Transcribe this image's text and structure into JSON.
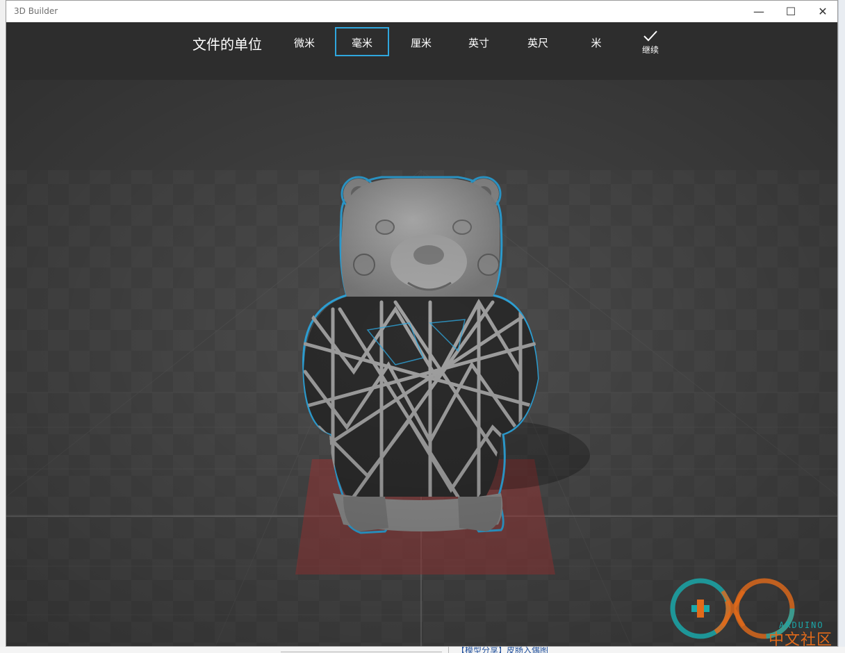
{
  "window": {
    "title": "3D Builder",
    "controls": {
      "minimize": "—",
      "maximize": "☐",
      "close": "✕"
    }
  },
  "toolbar": {
    "title": "文件的单位",
    "units": [
      {
        "label": "微米",
        "selected": false
      },
      {
        "label": "毫米",
        "selected": true
      },
      {
        "label": "厘米",
        "selected": false
      },
      {
        "label": "英寸",
        "selected": false
      },
      {
        "label": "英尺",
        "selected": false
      },
      {
        "label": "米",
        "selected": false
      }
    ],
    "continue_label": "继续",
    "continue_icon": "checkmark-icon"
  },
  "viewport": {
    "model": "lattice-bear",
    "selection_color": "#2fa7de",
    "platform_color": "#a53a3a"
  },
  "watermark": {
    "text_cn": "中文社区",
    "text_en": "ARDUINO"
  },
  "background_page": {
    "link_text": "【模型分享】皮肠入偶图"
  },
  "colors": {
    "toolbar_bg": "#2d2d2d",
    "viewport_bg": "#474747",
    "accent": "#2fa7de"
  }
}
